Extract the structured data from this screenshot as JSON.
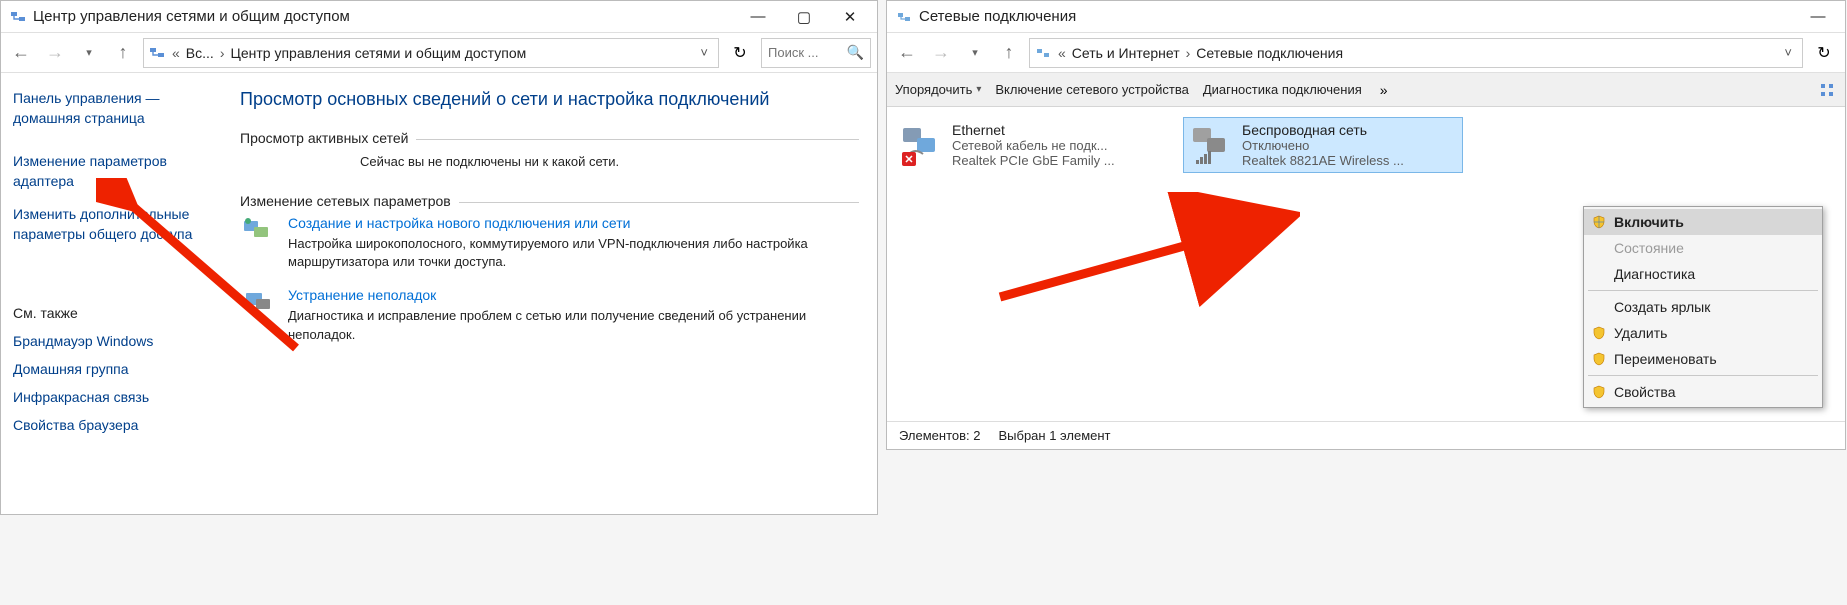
{
  "win1": {
    "title": "Центр управления сетями и общим доступом",
    "breadcrumb": {
      "pre": "Вс...",
      "current": "Центр управления сетями и общим доступом"
    },
    "search_placeholder": "Поиск ...",
    "sidebar": {
      "home": "Панель управления — домашняя страница",
      "adapter": "Изменение параметров адаптера",
      "sharing": "Изменить дополнительные параметры общего доступа",
      "seealso_title": "См. также",
      "firewall": "Брандмауэр Windows",
      "homegroup": "Домашняя группа",
      "infrared": "Инфракрасная связь",
      "browser": "Свойства браузера"
    },
    "heading": "Просмотр основных сведений о сети и настройка подключений",
    "active_networks": {
      "title": "Просмотр активных сетей",
      "msg": "Сейчас вы не подключены ни к какой сети."
    },
    "change_settings": {
      "title": "Изменение сетевых параметров",
      "tasks": {
        "newconn": {
          "link": "Создание и настройка нового подключения или сети",
          "desc": "Настройка широкополосного, коммутируемого или VPN-подключения либо настройка маршрутизатора или точки доступа."
        },
        "troubleshoot": {
          "link": "Устранение неполадок",
          "desc": "Диагностика и исправление проблем с сетью или получение сведений об устранении неполадок."
        }
      }
    }
  },
  "win2": {
    "title": "Сетевые подключения",
    "breadcrumb": {
      "parent": "Сеть и Интернет",
      "current": "Сетевые подключения"
    },
    "toolbar": {
      "arrange": "Упорядочить",
      "enable": "Включение сетевого устройства",
      "diagnose": "Диагностика подключения"
    },
    "adapters": [
      {
        "name": "Ethernet",
        "status": "Сетевой кабель не подк...",
        "device": "Realtek PCIe GbE Family ...",
        "selected": false,
        "kind": "ethernet"
      },
      {
        "name": "Беспроводная сеть",
        "status": "Отключено",
        "device": "Realtek 8821AE Wireless ...",
        "selected": true,
        "kind": "wifi"
      }
    ],
    "context_menu": {
      "enable": "Включить",
      "state": "Состояние",
      "diagnose": "Диагностика",
      "shortcut": "Создать ярлык",
      "delete": "Удалить",
      "rename": "Переименовать",
      "properties": "Свойства"
    },
    "status": {
      "elements": "Элементов: 2",
      "selected": "Выбран 1 элемент"
    }
  }
}
